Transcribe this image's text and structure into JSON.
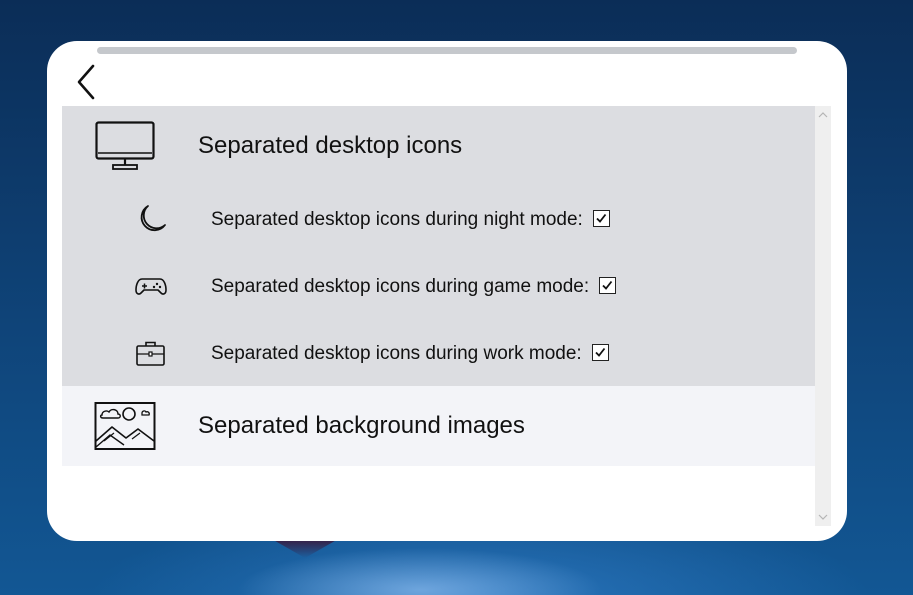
{
  "window": {
    "kind": "settings-panel",
    "back_icon": "chevron-left-icon"
  },
  "sections": [
    {
      "label": "Separated desktop icons",
      "icon": "monitor-icon",
      "options": [
        {
          "label": "Separated desktop icons during night mode:",
          "icon": "moon-icon",
          "checked": true
        },
        {
          "label": "Separated desktop icons during game mode:",
          "icon": "gamepad-icon",
          "checked": true
        },
        {
          "label": "Separated desktop icons during work mode:",
          "icon": "briefcase-icon",
          "checked": true
        }
      ]
    },
    {
      "label": "Separated background images",
      "icon": "landscape-image-icon"
    }
  ],
  "colors": {
    "panel_background": "#ffffff",
    "selected_group_background": "#dcdde1",
    "row_background": "#f3f4f8",
    "handle": "#c5c8cc",
    "scrollbar_track": "#efefef"
  }
}
